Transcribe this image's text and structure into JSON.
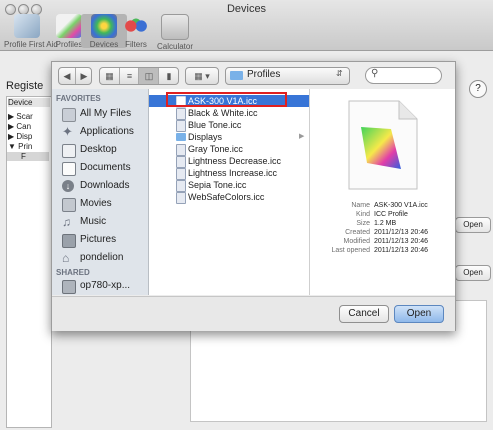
{
  "window": {
    "title": "Devices"
  },
  "toolbar": {
    "items": [
      {
        "label": "Profile First Aid",
        "icon": "first-aid-icon"
      },
      {
        "label": "Profiles",
        "icon": "profiles-icon"
      },
      {
        "label": "Devices",
        "icon": "devices-icon"
      },
      {
        "label": "Filters",
        "icon": "filters-icon"
      },
      {
        "label": "Calculator",
        "icon": "calculator-icon"
      }
    ]
  },
  "background": {
    "registered_label": "Registe",
    "device_header": "Device",
    "device_rows": [
      "▶ Scar",
      "▶ Can",
      "▶ Disp",
      "▼ Prin",
      "F"
    ],
    "open_buttons": [
      "Open",
      "Open"
    ],
    "help": "?"
  },
  "sheet": {
    "path": "Profiles",
    "search": {
      "value": ""
    },
    "sidebar": {
      "favorites_header": "FAVORITES",
      "favorites": [
        {
          "label": "All My Files",
          "icon": "all-files-icon"
        },
        {
          "label": "Applications",
          "icon": "applications-icon"
        },
        {
          "label": "Desktop",
          "icon": "desktop-icon"
        },
        {
          "label": "Documents",
          "icon": "documents-icon"
        },
        {
          "label": "Downloads",
          "icon": "downloads-icon"
        },
        {
          "label": "Movies",
          "icon": "movies-icon"
        },
        {
          "label": "Music",
          "icon": "music-icon"
        },
        {
          "label": "Pictures",
          "icon": "pictures-icon"
        },
        {
          "label": "pondelion",
          "icon": "home-icon"
        }
      ],
      "shared_header": "SHARED",
      "shared": [
        {
          "label": "op780-xp...",
          "icon": "network-computer-icon"
        }
      ]
    },
    "files": [
      {
        "name": "ASK-300 V1A.icc",
        "selected": true,
        "type": "icc"
      },
      {
        "name": "Black & White.icc",
        "selected": false,
        "type": "icc"
      },
      {
        "name": "Blue Tone.icc",
        "selected": false,
        "type": "icc"
      },
      {
        "name": "Displays",
        "selected": false,
        "type": "folder"
      },
      {
        "name": "Gray Tone.icc",
        "selected": false,
        "type": "icc"
      },
      {
        "name": "Lightness Decrease.icc",
        "selected": false,
        "type": "icc"
      },
      {
        "name": "Lightness Increase.icc",
        "selected": false,
        "type": "icc"
      },
      {
        "name": "Sepia Tone.icc",
        "selected": false,
        "type": "icc"
      },
      {
        "name": "WebSafeColors.icc",
        "selected": false,
        "type": "icc"
      }
    ],
    "info": {
      "name_key": "Name",
      "name": "ASK-300 V1A.icc",
      "kind_key": "Kind",
      "kind": "ICC Profile",
      "size_key": "Size",
      "size": "1.2 MB",
      "created_key": "Created",
      "created": "2011/12/13 20:46",
      "modified_key": "Modified",
      "modified": "2011/12/13 20:46",
      "opened_key": "Last opened",
      "opened": "2011/12/13 20:46"
    },
    "buttons": {
      "cancel": "Cancel",
      "open": "Open"
    }
  },
  "colors": {
    "selection": "#3875d7",
    "highlight_box": "#e02020",
    "open_button": "#8fb8ea"
  }
}
